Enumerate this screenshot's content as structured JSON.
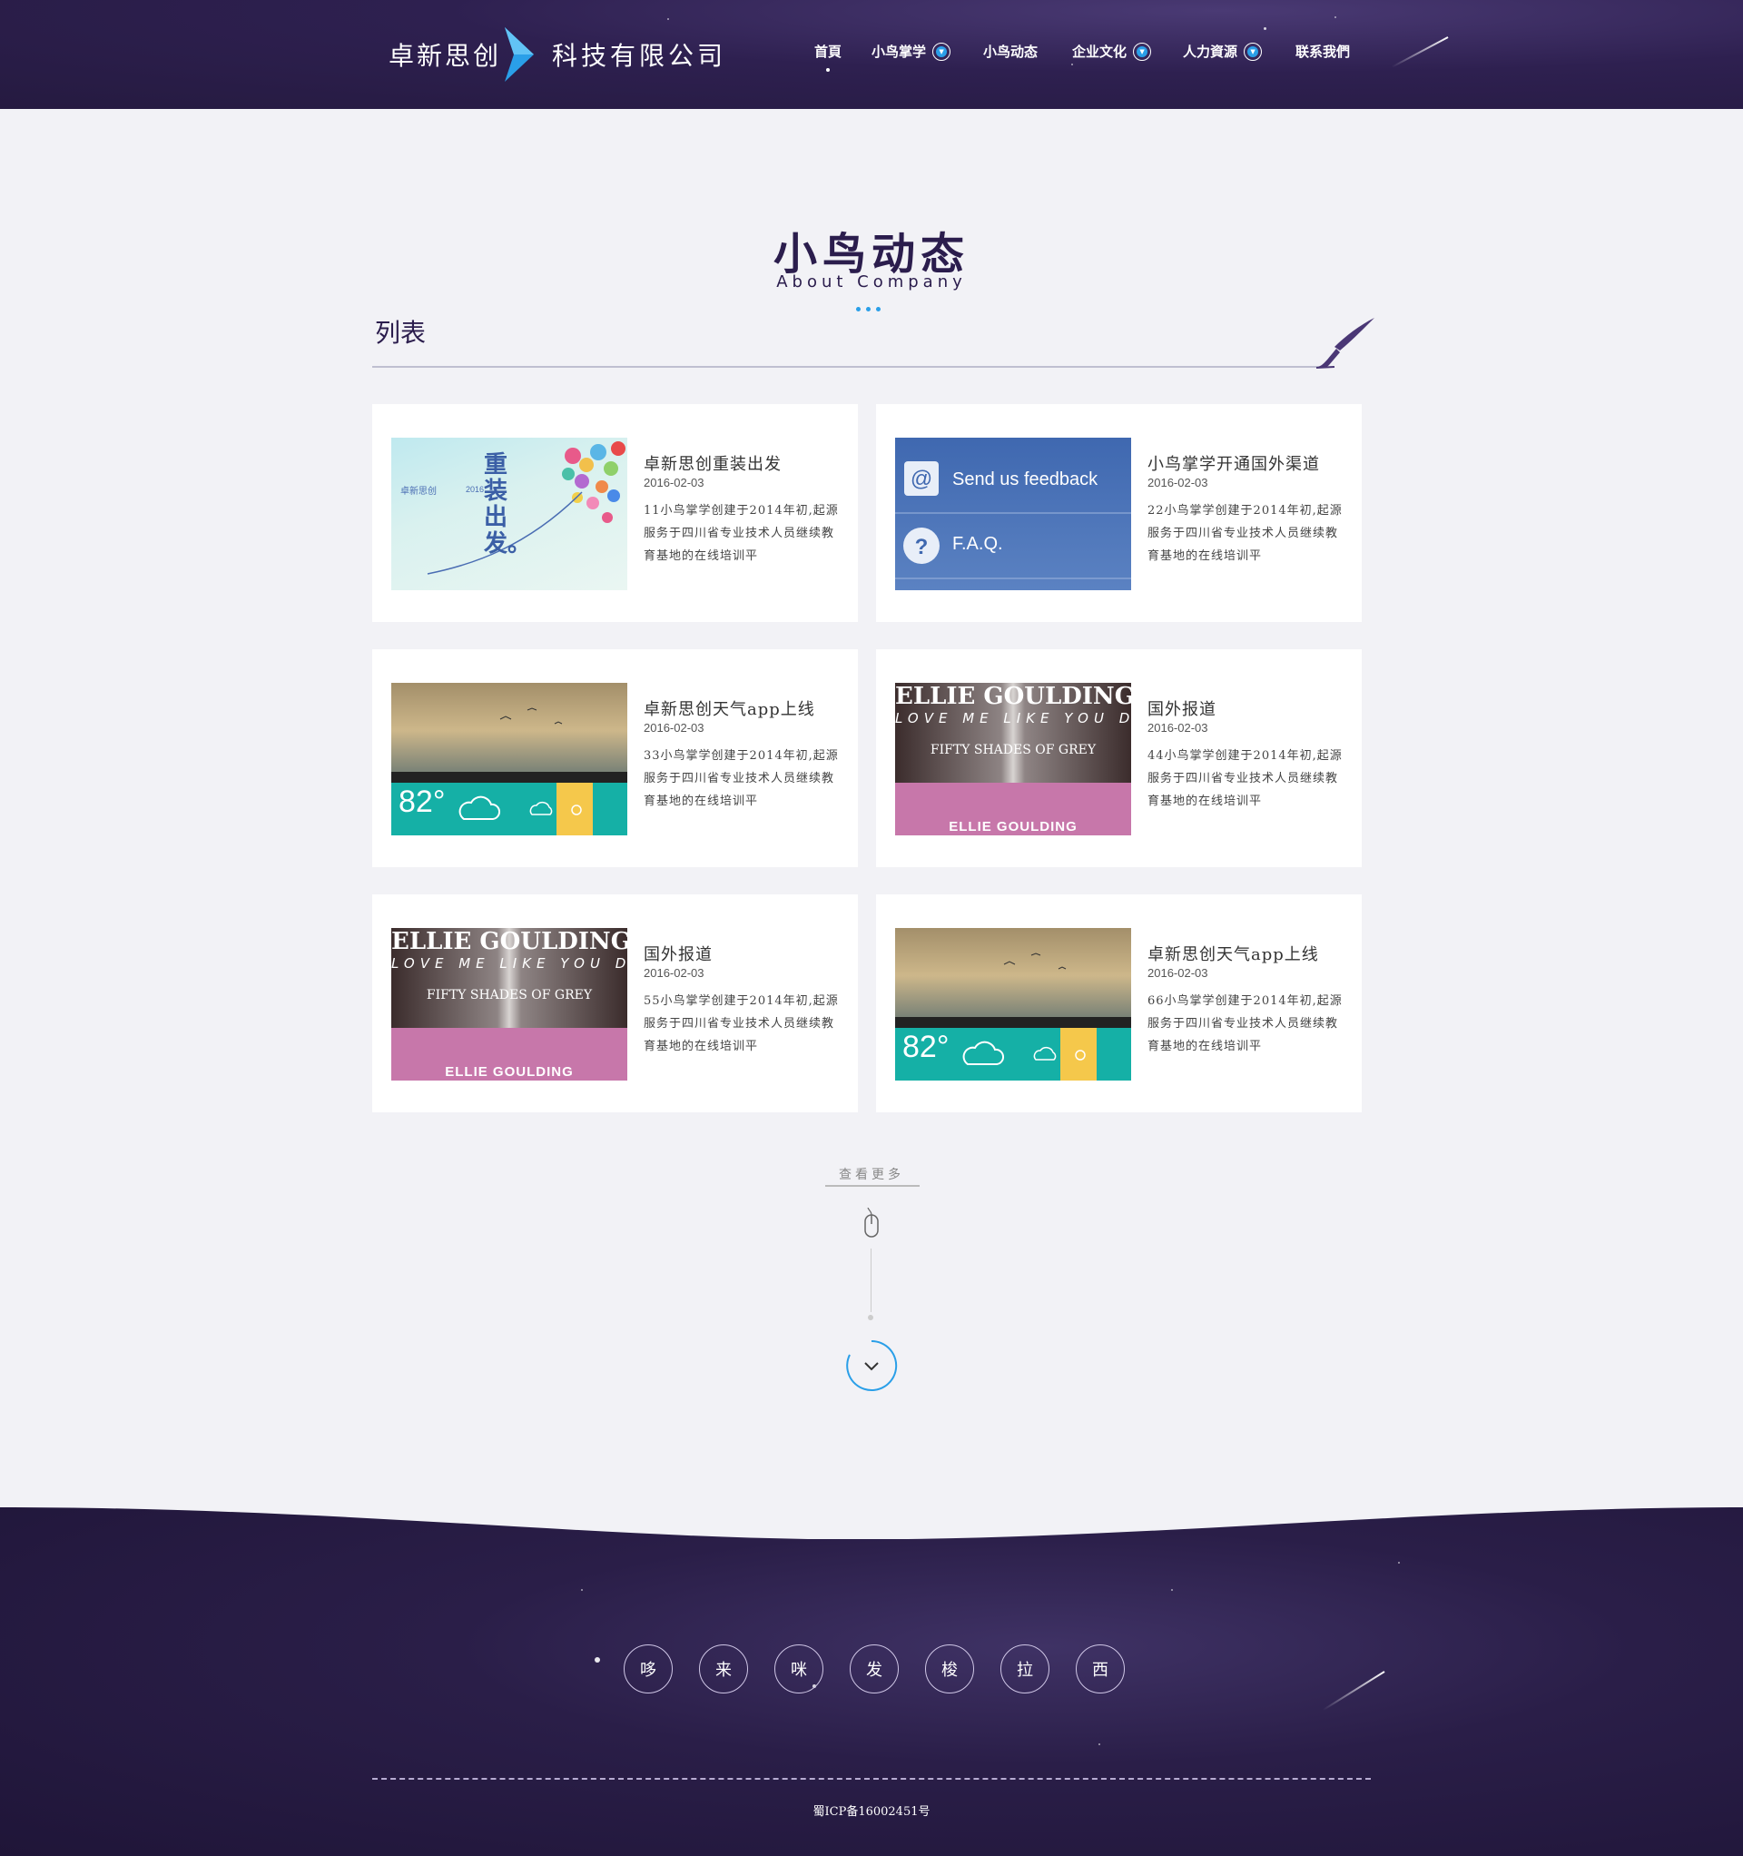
{
  "header": {
    "logo_left": "卓新思创",
    "logo_right": "科技有限公司",
    "nav": [
      {
        "label": "首頁",
        "dropdown": false
      },
      {
        "label": "小鸟掌学",
        "dropdown": true
      },
      {
        "label": "小鸟动态",
        "dropdown": false
      },
      {
        "label": "企业文化",
        "dropdown": true
      },
      {
        "label": "人力資源",
        "dropdown": true
      },
      {
        "label": "联系我們",
        "dropdown": false
      }
    ]
  },
  "section": {
    "title": "小鸟动态",
    "subtitle": "About Company",
    "list_label": "列表"
  },
  "cards": [
    {
      "title": "卓新思创重装出发",
      "date": "2016-02-03",
      "desc": "11小鸟掌学创建于2014年初,起源服务于四川省专业技术人员继续教育基地的在线培训平",
      "image": "balloon"
    },
    {
      "title": "小鸟掌学开通国外渠道",
      "date": "2016-02-03",
      "desc": "22小鸟掌学创建于2014年初,起源服务于四川省专业技术人员继续教育基地的在线培训平",
      "image": "faq"
    },
    {
      "title": "卓新思创天气app上线",
      "date": "2016-02-03",
      "desc": "33小鸟掌学创建于2014年初,起源服务于四川省专业技术人员继续教育基地的在线培训平",
      "image": "weather"
    },
    {
      "title": "国外报道",
      "date": "2016-02-03",
      "desc": "44小鸟掌学创建于2014年初,起源服务于四川省专业技术人员继续教育基地的在线培训平",
      "image": "ellie"
    },
    {
      "title": "国外报道",
      "date": "2016-02-03",
      "desc": "55小鸟掌学创建于2014年初,起源服务于四川省专业技术人员继续教育基地的在线培训平",
      "image": "ellie"
    },
    {
      "title": "卓新思创天气app上线",
      "date": "2016-02-03",
      "desc": "66小鸟掌学创建于2014年初,起源服务于四川省专业技术人员继续教育基地的在线培训平",
      "image": "weather"
    }
  ],
  "thumb_text": {
    "balloon_brand": "卓新思创",
    "balloon_year": "2016",
    "balloon_headline": "重装出发。",
    "faq_feedback": "Send us feedback",
    "faq_label": "F.A.Q.",
    "weather_temp": "82°",
    "ellie_name": "ELLIE GOULDING",
    "ellie_tagline": "LOVE ME LIKE YOU DO",
    "ellie_movie": "FIFTY SHADES OF GREY"
  },
  "more_label": "查看更多",
  "footer": {
    "buttons": [
      "哆",
      "来",
      "咪",
      "发",
      "梭",
      "拉",
      "西"
    ],
    "icp": "蜀ICP备16002451号"
  },
  "colors": {
    "header_bg": "#2e2050",
    "accent": "#2a9fe8",
    "title": "#2b1d4d",
    "page_bg": "#f2f2f6"
  },
  "icons": [
    "chevron-down-icon",
    "mouse-icon",
    "brush-icon",
    "logo-chevron-icon"
  ]
}
